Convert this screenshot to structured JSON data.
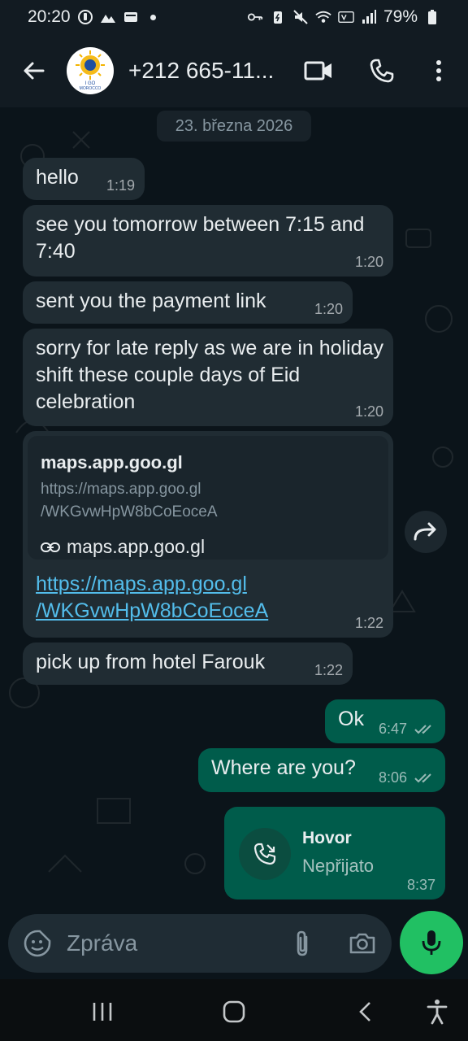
{
  "status_bar": {
    "time": "20:20",
    "battery": "79%"
  },
  "header": {
    "contact_name": "+212 665-11...",
    "avatar_label": "I GO MOROCCO"
  },
  "chat": {
    "date_chip": "23. března 2026",
    "messages": [
      {
        "dir": "in",
        "text": "hello",
        "time": "1:19"
      },
      {
        "dir": "in",
        "text": "see you tomorrow between 7:15 and 7:40",
        "time": "1:20"
      },
      {
        "dir": "in",
        "text": "sent you the payment link",
        "time": "1:20"
      },
      {
        "dir": "in",
        "text": "sorry for late reply as we are in holiday shift these couple days of Eid celebration",
        "time": "1:20"
      },
      {
        "dir": "in",
        "type": "link",
        "preview_title": "maps.app.goo.gl",
        "preview_desc_1": "https://maps.app.goo.gl",
        "preview_desc_2": "/WKGvwHpW8bCoEoceA",
        "preview_domain": "maps.app.goo.gl",
        "url_1": "https://maps.app.goo.gl",
        "url_2": "/WKGvwHpW8bCoEoceA",
        "time": "1:22"
      },
      {
        "dir": "in",
        "text": "pick up from hotel Farouk",
        "time": "1:22"
      },
      {
        "dir": "out",
        "text": "Ok",
        "time": "6:47"
      },
      {
        "dir": "out",
        "text": "Where are you?",
        "time": "8:06"
      },
      {
        "dir": "out",
        "type": "call",
        "title": "Hovor",
        "subtitle": "Nepřijato",
        "time": "8:37"
      }
    ]
  },
  "composer": {
    "placeholder": "Zpráva"
  },
  "colors": {
    "incoming_bubble": "#202c33",
    "outgoing_bubble": "#005c4b",
    "accent_green": "#21c063",
    "link_blue": "#53bdeb"
  }
}
